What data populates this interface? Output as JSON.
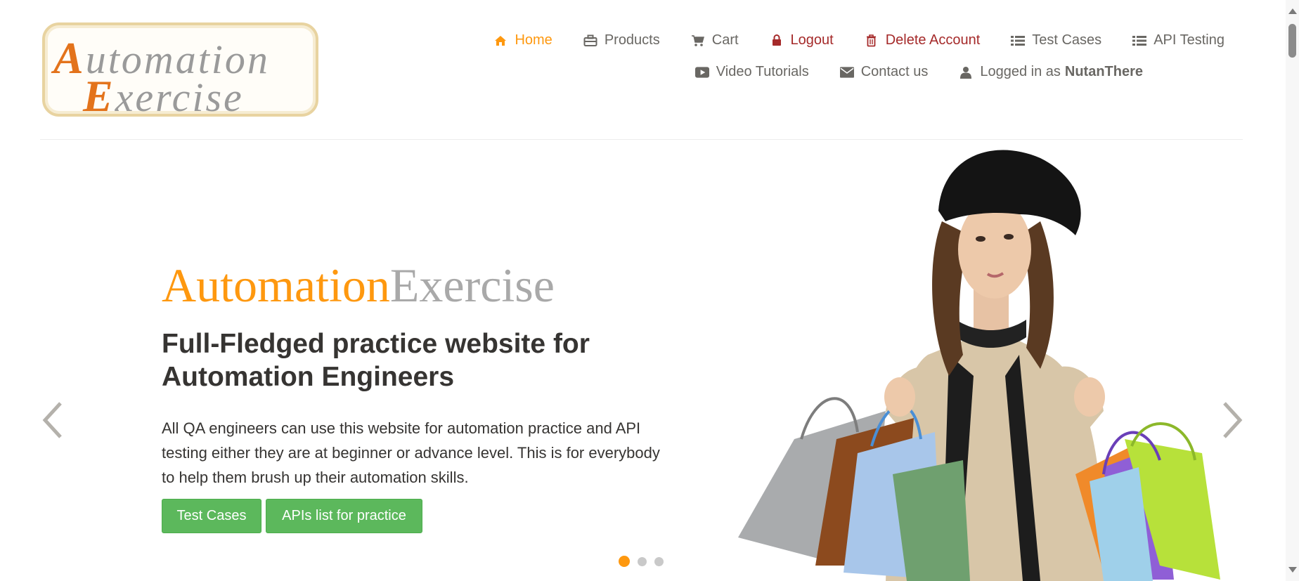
{
  "logo": {
    "line1_cap": "A",
    "line1_rest": "utomation",
    "line2_cap": "E",
    "line2_rest": "xercise"
  },
  "nav": {
    "row1": [
      {
        "label": "Home",
        "icon": "home-icon",
        "state": "active"
      },
      {
        "label": "Products",
        "icon": "briefcase-icon"
      },
      {
        "label": "Cart",
        "icon": "cart-icon"
      },
      {
        "label": "Logout",
        "icon": "lock-icon",
        "state": "danger"
      },
      {
        "label": "Delete Account",
        "icon": "trash-icon",
        "state": "danger"
      },
      {
        "label": "Test Cases",
        "icon": "list-icon"
      },
      {
        "label": "API Testing",
        "icon": "list-icon"
      }
    ],
    "row2": [
      {
        "label": "Video Tutorials",
        "icon": "youtube-play-icon"
      },
      {
        "label": "Contact us",
        "icon": "envelope-icon"
      },
      {
        "label": "Logged in as",
        "icon": "user-icon",
        "username": "NutanThere"
      }
    ]
  },
  "slider": {
    "brand_part1": "Automation",
    "brand_part2": "Exercise",
    "headline": "Full-Fledged practice website for Automation Engineers",
    "description": "All QA engineers can use this website for automation practice and API testing either they are at beginner or advance level. This is for everybody to help them brush up their automation skills.",
    "buttons": {
      "test_cases": "Test Cases",
      "apis_list": "APIs list for practice"
    },
    "dots": {
      "count": 3,
      "active": 0
    },
    "prev_icon": "chevron-left-icon",
    "next_icon": "chevron-right-icon"
  },
  "colors": {
    "accent": "#fe980f",
    "danger": "#a52a2a",
    "button_green": "#5cb85c",
    "text": "#696763",
    "heading": "#363432"
  }
}
